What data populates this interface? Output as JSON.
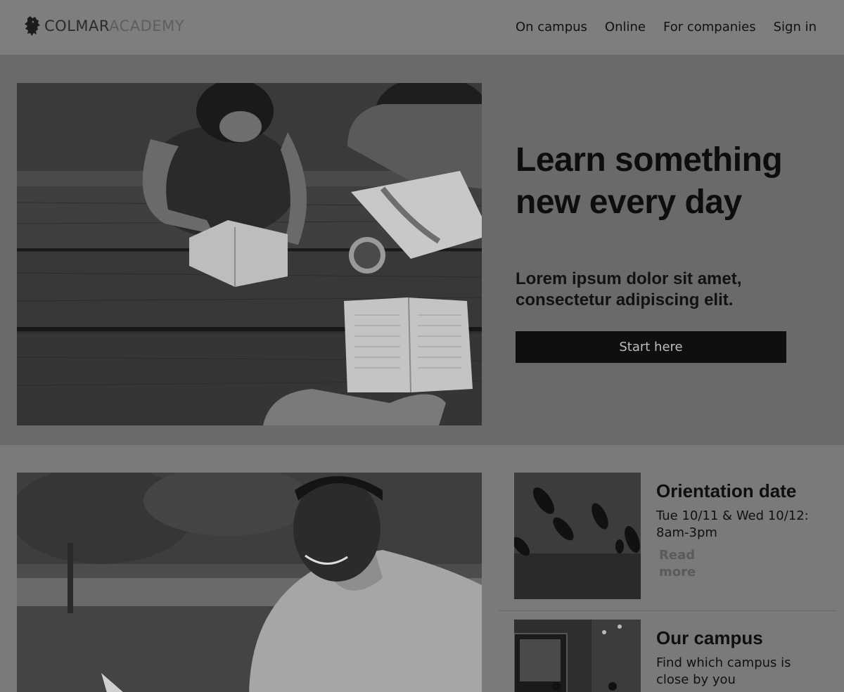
{
  "header": {
    "logo_part1": "COLMAR",
    "logo_part2": "ACADEMY",
    "logo_icon": "lion-icon",
    "nav": [
      {
        "label": "On campus"
      },
      {
        "label": "Online"
      },
      {
        "label": "For companies"
      },
      {
        "label": "Sign in"
      }
    ]
  },
  "hero": {
    "title": "Learn something new every day",
    "subtitle": "Lorem ipsum dolor sit amet, consectetur adipiscing elit.",
    "cta_label": "Start here"
  },
  "cards": [
    {
      "title": "Orientation date",
      "description": "Tue 10/11 & Wed 10/12: 8am-3pm",
      "link": "Read more"
    },
    {
      "title": "Our campus",
      "description": "Find which campus is close by you"
    }
  ],
  "colors": {
    "overlay": "#7a7a7a",
    "hero_bg": "#6a6a6a",
    "button_bg": "#0f0f0f",
    "button_text": "#bdbdbd"
  }
}
